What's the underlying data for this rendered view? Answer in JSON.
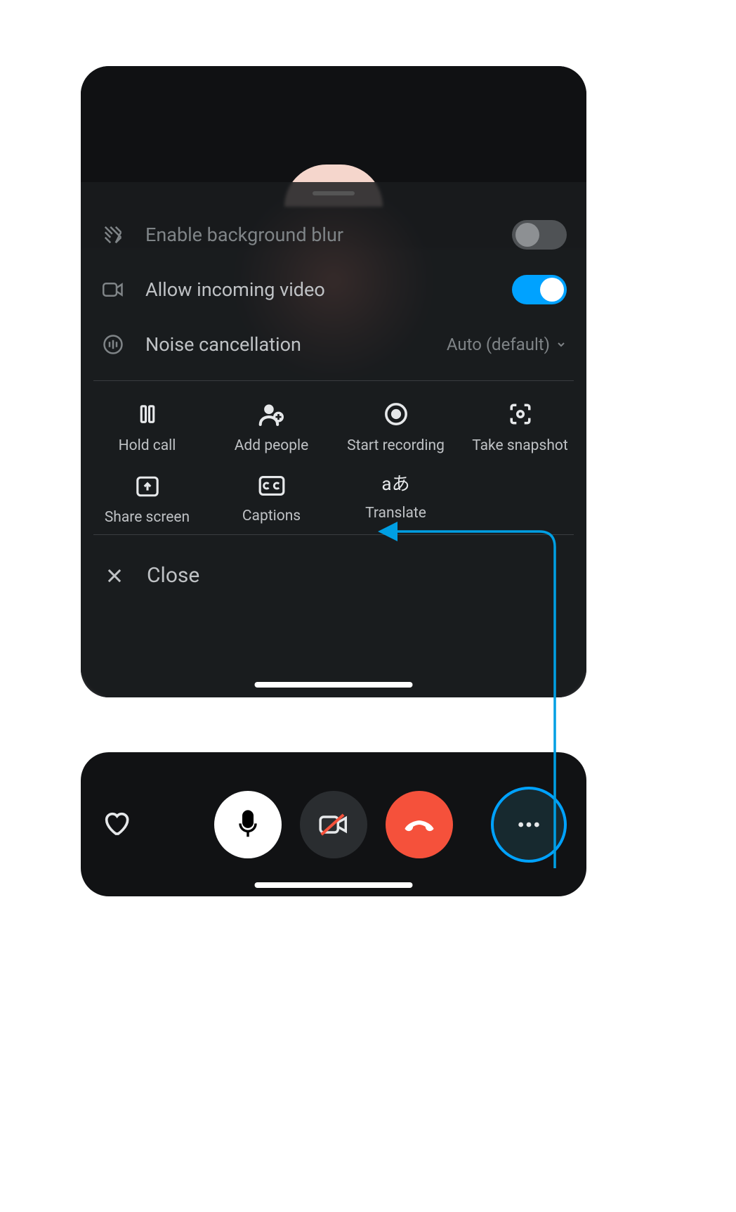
{
  "settings": {
    "blur": {
      "label": "Enable background blur",
      "on": false
    },
    "video": {
      "label": "Allow incoming video",
      "on": true
    },
    "noise": {
      "label": "Noise cancellation",
      "value": "Auto (default)"
    }
  },
  "actions": {
    "hold": "Hold call",
    "add": "Add people",
    "record": "Start recording",
    "snapshot": "Take snapshot",
    "share": "Share screen",
    "captions": "Captions",
    "translate": "Translate"
  },
  "close_label": "Close",
  "annotation": {
    "target": "translate-button",
    "source": "more-options-button"
  }
}
